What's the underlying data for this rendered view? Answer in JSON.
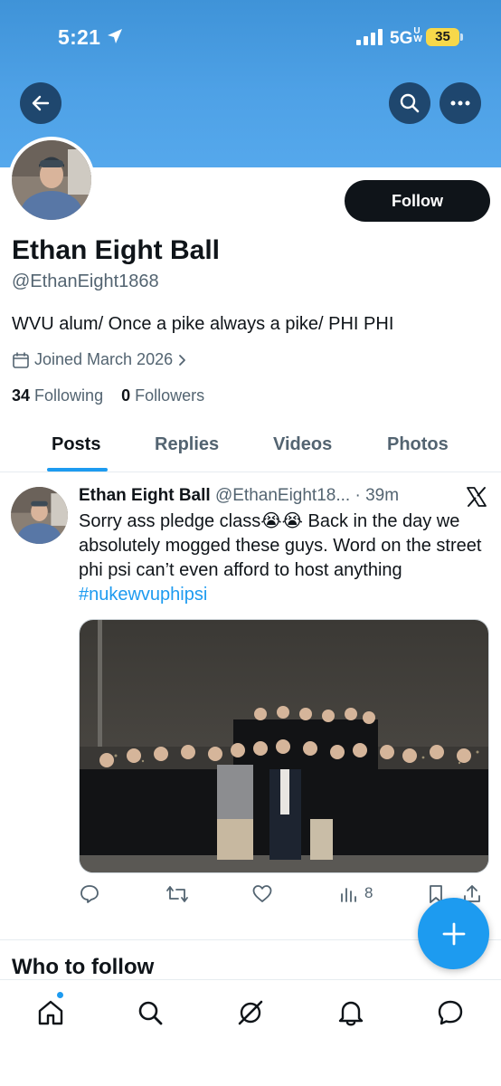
{
  "status_bar": {
    "time": "5:21",
    "network": "5G",
    "network_suffix": "UW",
    "battery": "35"
  },
  "header": {
    "back_icon": "arrow-left-icon",
    "search_icon": "search-icon",
    "more_icon": "more-horizontal-icon"
  },
  "profile": {
    "display_name": "Ethan Eight Ball",
    "handle": "@EthanEight1868",
    "follow_label": "Follow",
    "bio": "WVU alum/ Once a pike always a pike/ PHI PHI",
    "joined": "Joined March 2026",
    "following_count": "34",
    "following_label": "Following",
    "followers_count": "0",
    "followers_label": "Followers"
  },
  "tabs": [
    {
      "label": "Posts",
      "active": true
    },
    {
      "label": "Replies",
      "active": false
    },
    {
      "label": "Videos",
      "active": false
    },
    {
      "label": "Photos",
      "active": false
    }
  ],
  "post": {
    "author": "Ethan Eight Ball",
    "handle": "@EthanEight18...",
    "time": "39m",
    "text": "Sorry ass pledge class😭😭 Back in the day we absolutely mogged these guys. Word on the street phi psi can’t even afford to host anything",
    "hashtag": "#nukewvuphipsi",
    "views": "8"
  },
  "sections": {
    "who_to_follow": "Who to follow"
  },
  "colors": {
    "accent": "#1d9bf0",
    "banner": "#4a9de4",
    "text_primary": "#0f1419",
    "text_secondary": "#536471"
  }
}
